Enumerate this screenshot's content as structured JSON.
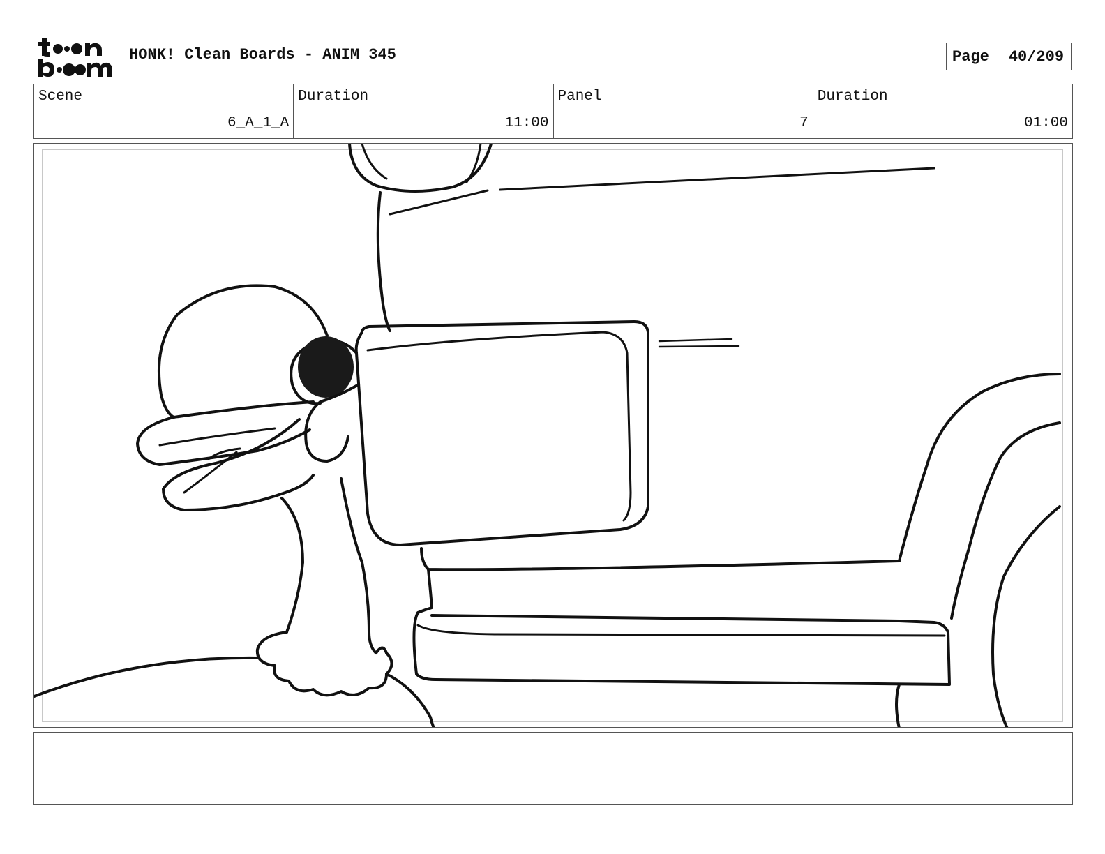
{
  "header": {
    "logo_text": "toon boom",
    "title": "HONK! Clean Boards - ANIM 345",
    "page_label": "Page",
    "page_number": "40/209"
  },
  "info": {
    "scene_label": "Scene",
    "scene_value": "6_A_1_A",
    "scene_duration_label": "Duration",
    "scene_duration_value": "11:00",
    "panel_label": "Panel",
    "panel_value": "7",
    "panel_duration_label": "Duration",
    "panel_duration_value": "01:00"
  },
  "notes": {
    "text": ""
  }
}
